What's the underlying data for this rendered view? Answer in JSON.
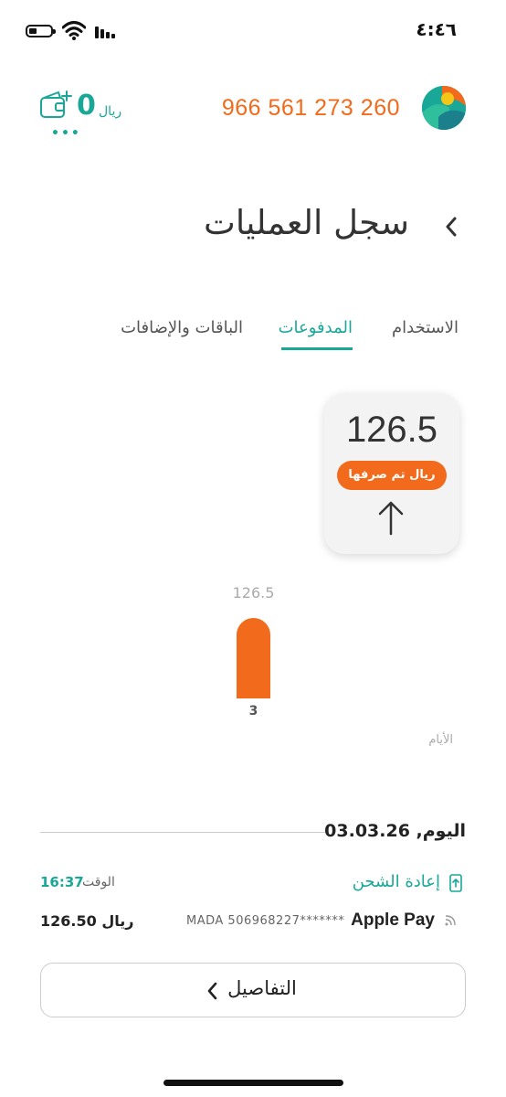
{
  "status_bar": {
    "time": "٤:٤٦"
  },
  "account": {
    "balance_value": "0",
    "balance_unit": "ريال",
    "wallet_more": "•••",
    "phone": "966 561 273 260"
  },
  "page": {
    "title": "سجل العمليات"
  },
  "tabs": [
    {
      "label": "الاستخدام",
      "active": false
    },
    {
      "label": "المدفوعات",
      "active": true
    },
    {
      "label": "الباقات والإضافات",
      "active": false
    }
  ],
  "summary": {
    "spent_value": "126.5",
    "spent_label": "ريال تم صرفها"
  },
  "chart_data": {
    "type": "bar",
    "categories": [
      "3"
    ],
    "values": [
      126.5
    ],
    "data_labels": [
      "126.5"
    ],
    "xlabel": "الأيام",
    "ylabel": "",
    "title": ""
  },
  "date_row": {
    "label": "اليوم, 03.03.26"
  },
  "transaction": {
    "type_label": "إعادة الشحن",
    "time_label": "الوقت",
    "time_value": "16:37",
    "payment_method": "Apple Pay",
    "card_number": "MADA 506968227*******",
    "amount": "126.50 ريال"
  },
  "details_button": {
    "label": "التفاصيل"
  },
  "colors": {
    "accent": "#19a897",
    "brand_orange": "#f26a1b"
  }
}
